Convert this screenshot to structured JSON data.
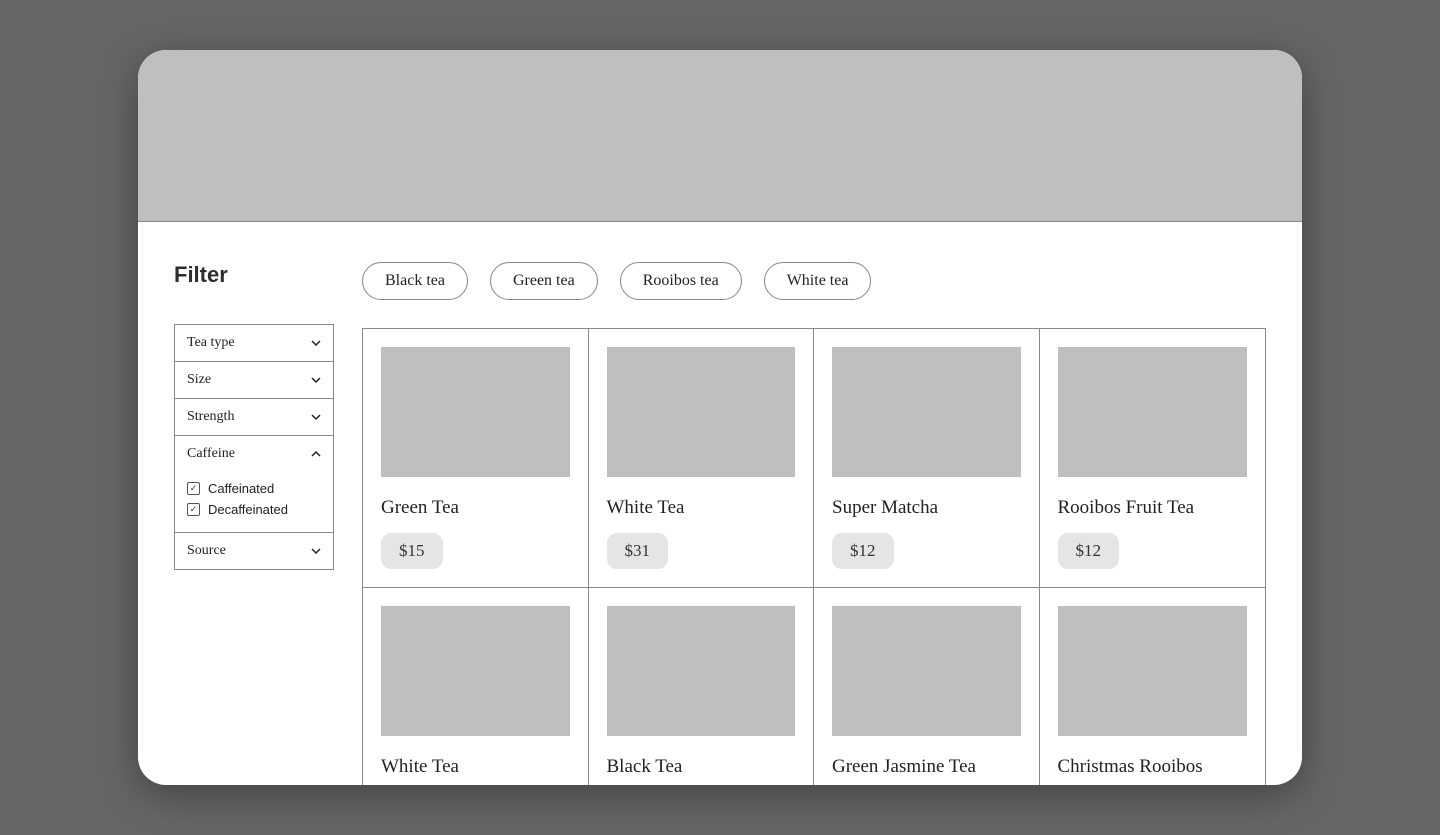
{
  "sidebar": {
    "title": "Filter",
    "sections": [
      {
        "label": "Tea type",
        "expanded": false
      },
      {
        "label": "Size",
        "expanded": false
      },
      {
        "label": "Strength",
        "expanded": false
      },
      {
        "label": "Caffeine",
        "expanded": true,
        "options": [
          {
            "label": "Caffeinated",
            "checked": true
          },
          {
            "label": "Decaffeinated",
            "checked": true
          }
        ]
      },
      {
        "label": "Source",
        "expanded": false
      }
    ]
  },
  "chips": [
    {
      "label": "Black tea"
    },
    {
      "label": "Green tea"
    },
    {
      "label": "Rooibos tea"
    },
    {
      "label": "White tea"
    }
  ],
  "products": [
    {
      "name": "Green Tea",
      "price": "$15"
    },
    {
      "name": "White Tea",
      "price": "$31"
    },
    {
      "name": "Super Matcha",
      "price": "$12"
    },
    {
      "name": "Rooibos Fruit Tea",
      "price": "$12"
    },
    {
      "name": "White Tea",
      "price": ""
    },
    {
      "name": "Black Tea",
      "price": ""
    },
    {
      "name": "Green Jasmine Tea",
      "price": ""
    },
    {
      "name": "Christmas Rooibos",
      "price": ""
    }
  ]
}
